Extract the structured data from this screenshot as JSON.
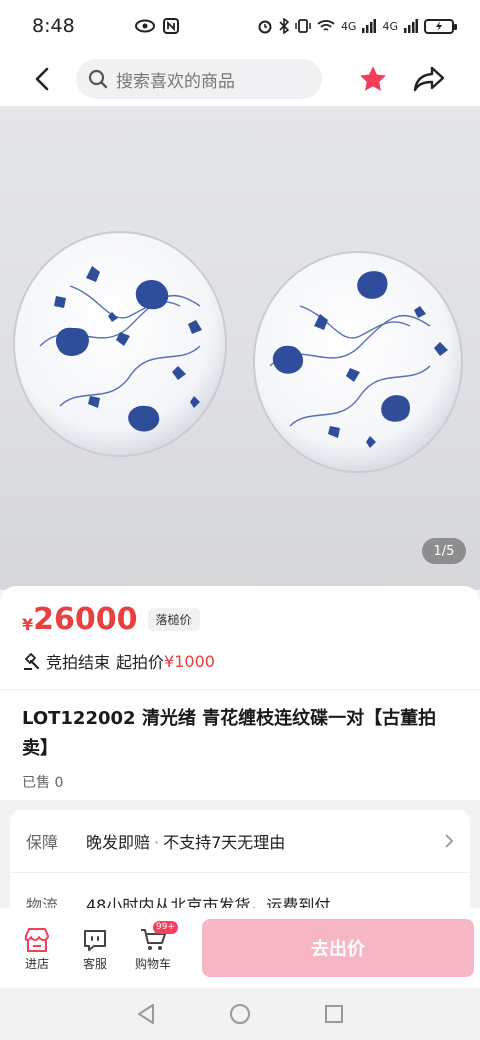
{
  "status_bar": {
    "time": "8:48",
    "network_1": "4G",
    "network_2": "4G",
    "battery_level": 1.0
  },
  "header": {
    "search_placeholder": "搜索喜欢的商品",
    "favorite_active": true,
    "accent_color": "#ef3d5a"
  },
  "gallery": {
    "page_indicator": "1/5",
    "current_page": 1,
    "total_pages": 5
  },
  "product": {
    "currency": "¥",
    "price": "26000",
    "price_tag": "落槌价",
    "auction_status": "竞拍结束",
    "start_price_label": "起拍价",
    "start_price": "¥1000",
    "title": "LOT122002 清光绪 青花缠枝连纹碟一对【古董拍卖】",
    "sold": "已售 0",
    "price_color": "#e8403f"
  },
  "services": {
    "guarantee_label": "保障",
    "guarantee_item_1": "晚发即赔",
    "separator": "·",
    "guarantee_item_2": "不支持7天无理由",
    "logistics_label": "物流",
    "logistics_value": "48小时内从北京市发货，运费到付"
  },
  "action_bar": {
    "store_label": "进店",
    "service_label": "客服",
    "cart_label": "购物车",
    "cart_badge": "99+",
    "bid_button": "去出价",
    "bid_color": "#f7b6c4"
  }
}
